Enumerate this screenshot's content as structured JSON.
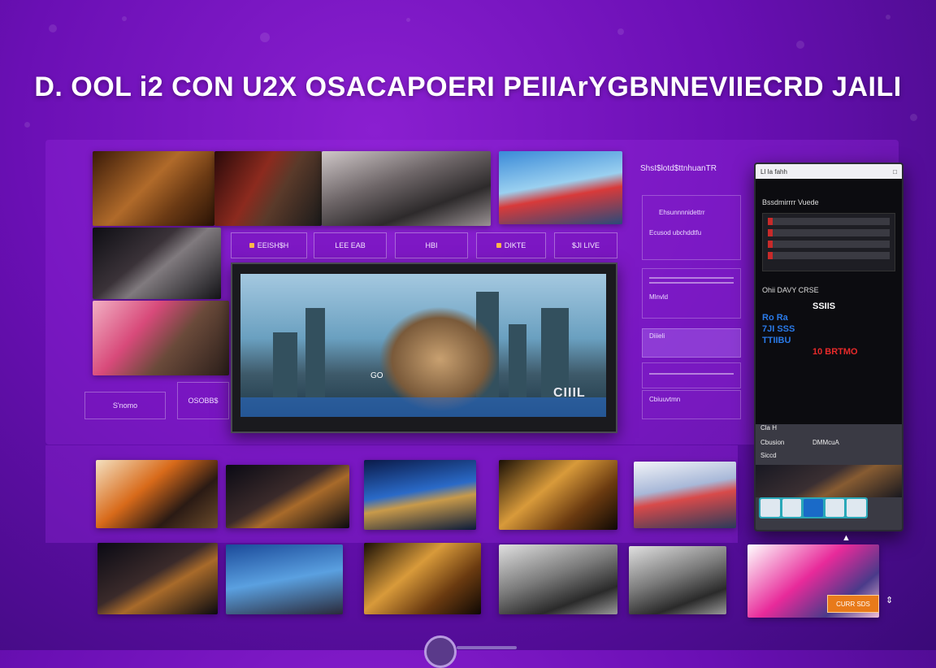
{
  "headline": "D. OOL i2  CON U2X OSACAPOERI PEIIArYGBNNEVIIECRD JAILI",
  "sidebar_label": "S'nomo",
  "sidebar_label2": "OSOBB$",
  "chips": [
    {
      "label": "EEISH$H"
    },
    {
      "label": "LEE EAB"
    },
    {
      "label": "HBI"
    },
    {
      "label": "DIKTE"
    },
    {
      "label": "$JI LIVE"
    }
  ],
  "player": {
    "overlay_text": "CIIIL",
    "hd_badge": "GO"
  },
  "side_panel": {
    "title": "ShsI$lotd$ttnhuanTR",
    "block1_label": "Ehsunnnnidettrr",
    "block1_sub": "Ecusod ubchddtfu",
    "block2_label": "Mlnvld",
    "block3_label": "Diiieli",
    "block4_label": "Cbiuuvtmn"
  },
  "phone": {
    "status_left": "Ll Ia fahh",
    "status_right": "□",
    "section1_title": "Bssdmirrrr Vuede",
    "section2_title": "Ohii DAVY CRSE",
    "score_line1": "SSIIS",
    "score_line2": "Ro Ra",
    "score_line3": "7JI SSS",
    "score_line4": "TTIIBU",
    "score_line5": "10 BRTMO",
    "footer_label1": "Cla H",
    "footer_label2": "Cbusion",
    "footer_label3": "DMMcuA",
    "footer_label4": "Siccd"
  },
  "cta_label": "CURR SDS"
}
